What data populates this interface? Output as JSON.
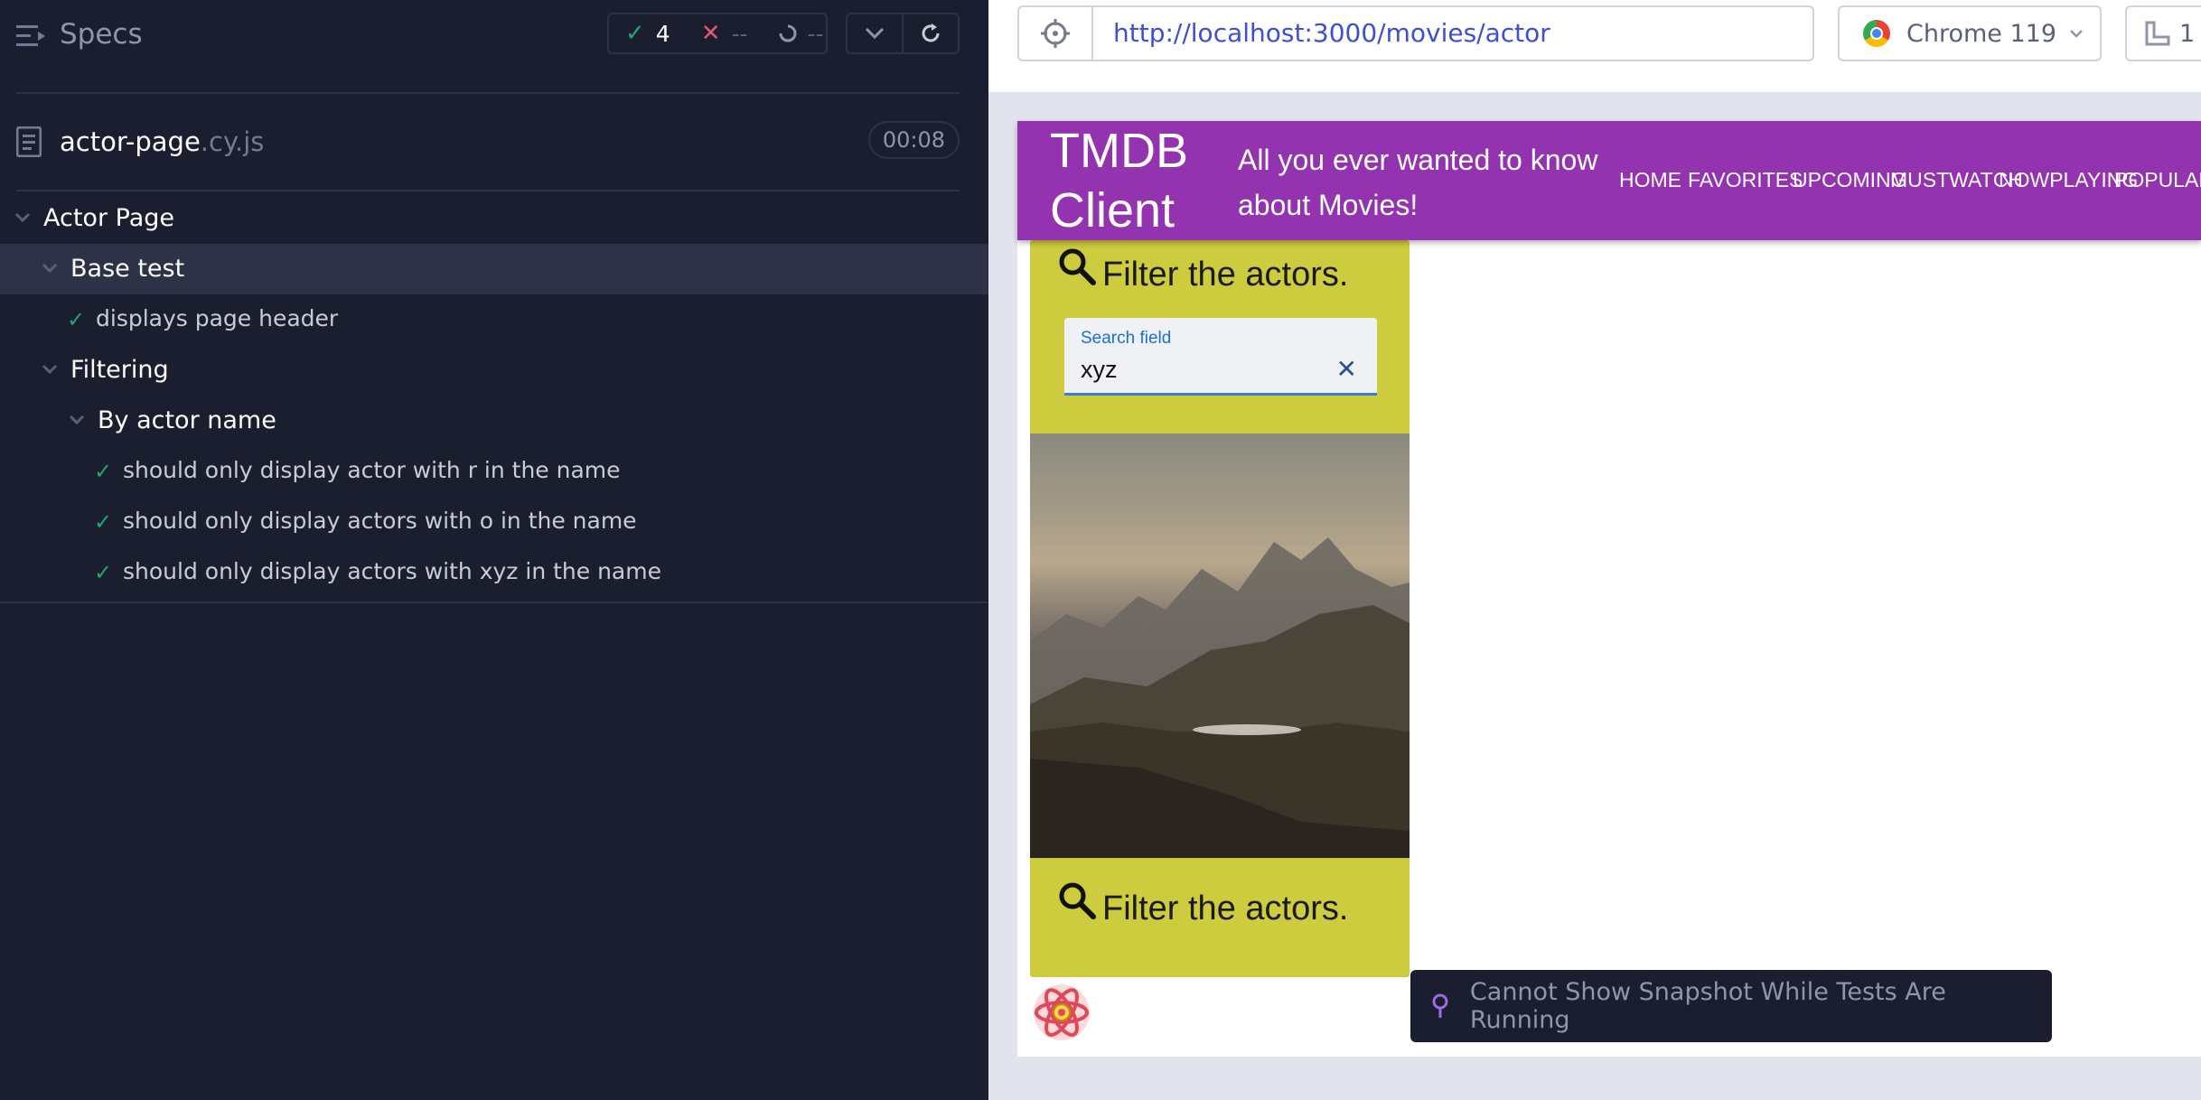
{
  "runner": {
    "title": "Specs",
    "stats": {
      "passed": "4",
      "failed": "--",
      "pending": "--"
    },
    "spec_file": {
      "name": "actor-page",
      "ext": ".cy.js",
      "duration": "00:08"
    },
    "tree": [
      {
        "label": "Actor Page",
        "kind": "suite"
      },
      {
        "label": "Base test",
        "kind": "suite"
      },
      {
        "label": "displays page header",
        "kind": "test",
        "status": "passed"
      },
      {
        "label": "Filtering",
        "kind": "suite"
      },
      {
        "label": "By actor name",
        "kind": "suite"
      },
      {
        "label": "should only display actor with r in the name",
        "kind": "test",
        "status": "passed"
      },
      {
        "label": "should only display actors with o in the name",
        "kind": "test",
        "status": "passed"
      },
      {
        "label": "should only display actors with xyz in the name",
        "kind": "test",
        "status": "passed"
      }
    ]
  },
  "aut": {
    "url": "http://localhost:3000/movies/actor",
    "browser": "Chrome 119",
    "viewport_label": "1"
  },
  "app": {
    "brand": "TMDB Client",
    "tagline": "All you ever wanted to know about Movies!",
    "nav": [
      "HOME",
      "FAVORITES",
      "UPCOMING",
      "MUSTWATCH",
      "NOWPLAYING",
      "POPULAR"
    ],
    "filter_title": "Filter the actors.",
    "search_label": "Search field",
    "search_value": "xyz",
    "filter_title_2": "Filter the actors."
  },
  "toast": "Cannot Show Snapshot While Tests Are Running",
  "colors": {
    "runner_bg": "#1b1e2e",
    "pass": "#1fa971",
    "fail": "#e45770",
    "appbar": "#9333b0",
    "panel": "#cdcb3e",
    "url": "#3d4fd3"
  }
}
